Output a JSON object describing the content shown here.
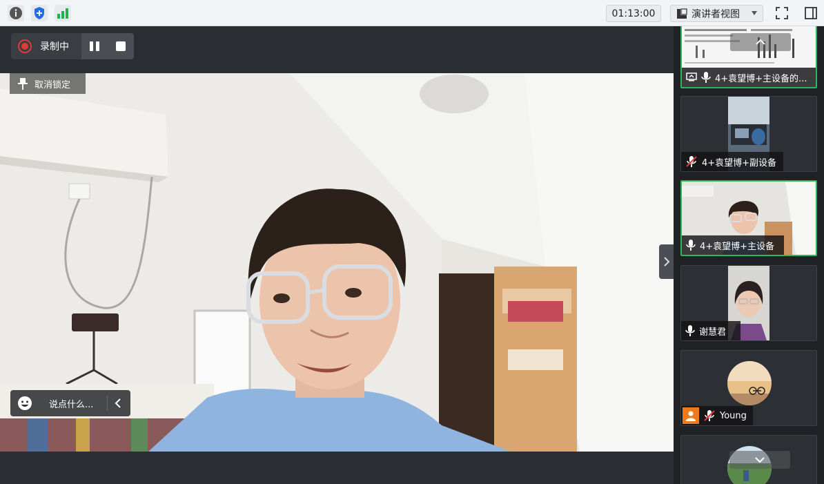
{
  "topbar": {
    "timer": "01:13:00",
    "view_mode": "演讲者视图",
    "icons": [
      "info-icon",
      "shield-plus-icon",
      "signal-bars-icon",
      "fullscreen-icon",
      "sidebar-panel-icon"
    ]
  },
  "recording": {
    "status_label": "录制中"
  },
  "main_video": {
    "unpin_label": "取消锁定",
    "chat_placeholder": "说点什么..."
  },
  "participants": [
    {
      "name": "4+袁望博+主设备的...",
      "mic": "on",
      "screen_share": true,
      "active": true
    },
    {
      "name": "4+袁望博+副设备",
      "mic": "muted",
      "screen_share": false,
      "active": false
    },
    {
      "name": "4+袁望博+主设备",
      "mic": "on",
      "screen_share": false,
      "active": true
    },
    {
      "name": "谢慧君",
      "mic": "on",
      "screen_share": false,
      "active": false
    },
    {
      "name": "Young",
      "mic": "muted",
      "screen_share": false,
      "active": false,
      "avatar": "person-icon"
    },
    {
      "name": "",
      "mic": "",
      "screen_share": false,
      "active": false
    }
  ],
  "colors": {
    "accent_green": "#2fb75a",
    "record_red": "#e03b3b",
    "signal_green": "#1fb24a",
    "shield_blue": "#1f6fe0"
  }
}
